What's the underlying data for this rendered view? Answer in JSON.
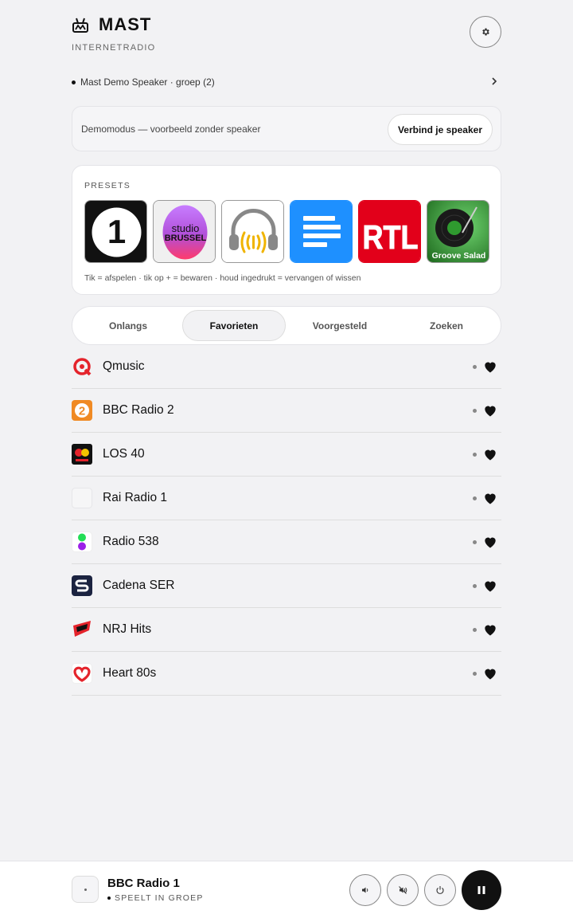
{
  "app": {
    "title": "MAST",
    "subtitle": "INTERNETRADIO",
    "logo_icon": "radio-logo-icon",
    "settings_icon": "gear-icon"
  },
  "speaker": {
    "label": "Mast Demo Speaker · groep (2)"
  },
  "demo": {
    "text": "Demomodus — voorbeeld zonder speaker",
    "connect_label": "Verbind je speaker"
  },
  "presets": {
    "title": "PRESETS",
    "items": [
      {
        "name": "BBC Radio 1",
        "logo_text": "1"
      },
      {
        "name": "Studio Brussel",
        "logo_text": "studio BRUSSEL"
      },
      {
        "name": "Headphones station",
        "logo_text": ""
      },
      {
        "name": "Deutschlandfunk",
        "logo_text": ""
      },
      {
        "name": "RTL",
        "logo_text": "RTL"
      },
      {
        "name": "Groove Salad",
        "logo_text": "Groove Salad"
      }
    ],
    "hint": "Tik = afspelen · tik op + = bewaren · houd ingedrukt = vervangen of wissen"
  },
  "tabs": [
    {
      "label": "Onlangs",
      "active": false
    },
    {
      "label": "Favorieten",
      "active": true
    },
    {
      "label": "Voorgesteld",
      "active": false
    },
    {
      "label": "Zoeken",
      "active": false
    }
  ],
  "stations": [
    {
      "name": "Qmusic",
      "favorite": true
    },
    {
      "name": "BBC Radio 2",
      "favorite": true
    },
    {
      "name": "LOS 40",
      "favorite": true
    },
    {
      "name": "Rai Radio 1",
      "favorite": true
    },
    {
      "name": "Radio 538",
      "favorite": true
    },
    {
      "name": "Cadena SER",
      "favorite": true
    },
    {
      "name": "NRJ Hits",
      "favorite": true
    },
    {
      "name": "Heart 80s",
      "favorite": true
    }
  ],
  "now_playing": {
    "title": "BBC Radio 1",
    "status": "SPEELT IN GROEP"
  },
  "colors": {
    "accent": "#111111",
    "background": "#f2f2f4",
    "rtl_red": "#e2001a",
    "dlf_blue": "#1e90ff",
    "groove_green": "#2f9a2f"
  }
}
